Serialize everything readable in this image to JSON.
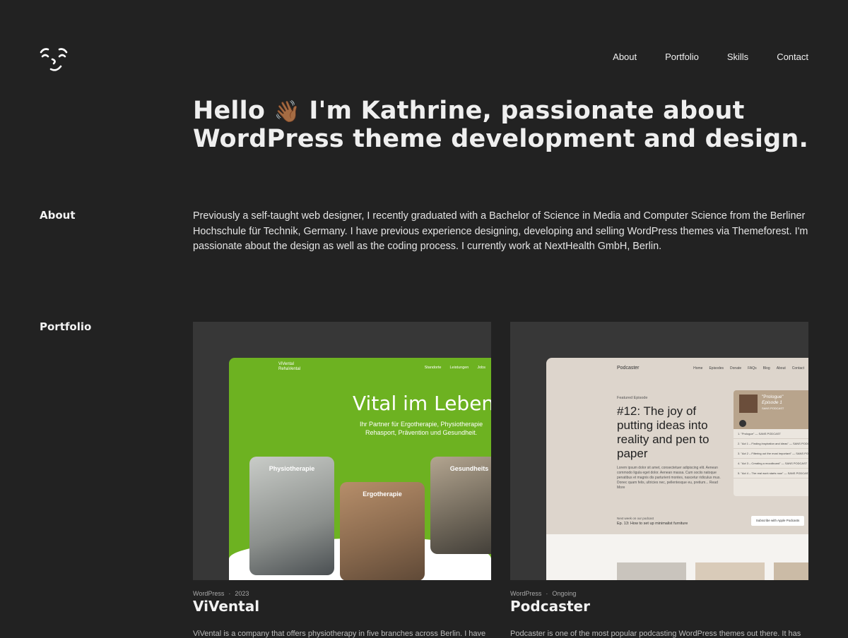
{
  "nav": {
    "items": [
      "About",
      "Portfolio",
      "Skills",
      "Contact"
    ]
  },
  "hero": {
    "greeting": "Hello",
    "emoji": "👋🏾",
    "headline": "I'm Kathrine, passionate about WordPress theme development and design."
  },
  "about": {
    "label": "About",
    "text": "Previously a self-taught web designer, I recently graduated with a Bachelor of Science in Media and Computer Science from the Berliner Hochschule für Technik, Germany. I have previous experience designing, developing and selling WordPress themes via Themeforest. I'm passionate about the design as well as the coding process. I currently work at NextHealth GmbH, Berlin."
  },
  "portfolio": {
    "label": "Portfolio",
    "projects": [
      {
        "category": "WordPress",
        "separator": "·",
        "date": "2023",
        "title": "ViVental",
        "description": "ViVental is a company that offers physiotherapy in five branches across Berlin. I have",
        "mockup": {
          "brand": [
            "ViVental",
            "RehaVental"
          ],
          "nav": [
            "Standorte",
            "Leistungen",
            "Jobs"
          ],
          "headline": "Vital im Leben",
          "subline": [
            "Ihr Partner für Ergotherapie, Physiotherapie",
            "Rehasport, Prävention und Gesundheit."
          ],
          "cards": [
            "Physiotherapie",
            "Ergotherapie",
            "Gesundheits"
          ],
          "accent": "#6db221"
        }
      },
      {
        "category": "WordPress",
        "separator": "·",
        "date": "Ongoing",
        "title": "Podcaster",
        "description": "Podcaster is one of the most popular podcasting WordPress themes out there. It has",
        "mockup": {
          "brand": "Podcaster",
          "nav": [
            "Home",
            "Episodes",
            "Donate",
            "FAQs",
            "Blog",
            "About",
            "Contact"
          ],
          "featured_label": "Featured Episode",
          "featured_title": "#12: The joy of putting ideas into reality and pen to paper",
          "featured_body": "Lorem ipsum dolor sit amet, consectetuer adipiscing elit. Aenean commodo ligula eget dolor. Aenean massa. Cum sociis natoque penatibus et magnis dis parturient montes, nascetur ridiculus mus. Donec quam felis, ultricies nec, pellentesque eu, pretium... Read More",
          "player_title": "\"Prologue\"",
          "player_episode": "Episode 1",
          "player_show": "SANS PODCAST",
          "playlist": [
            "1. \"Prologue\" — SANS PODCAST",
            "2. \"Act 1 – Finding inspiration and ideas\" — SANS PODCAST",
            "3. \"Act 2 – Filtering out the most important\" — SANS PODCAST",
            "4. \"Act 3 – Creating a moodboard\" — SANS PODCAST",
            "5. \"Act 4 – The real work starts now\" — SANS PODCAST"
          ],
          "next_label": "Next week on our podcast",
          "next_title": "Ep. 13: How to set up minimalist furniture",
          "subscribe": "Subscribe with Apple Podcasts",
          "background": "#ddd5cc"
        }
      }
    ]
  }
}
